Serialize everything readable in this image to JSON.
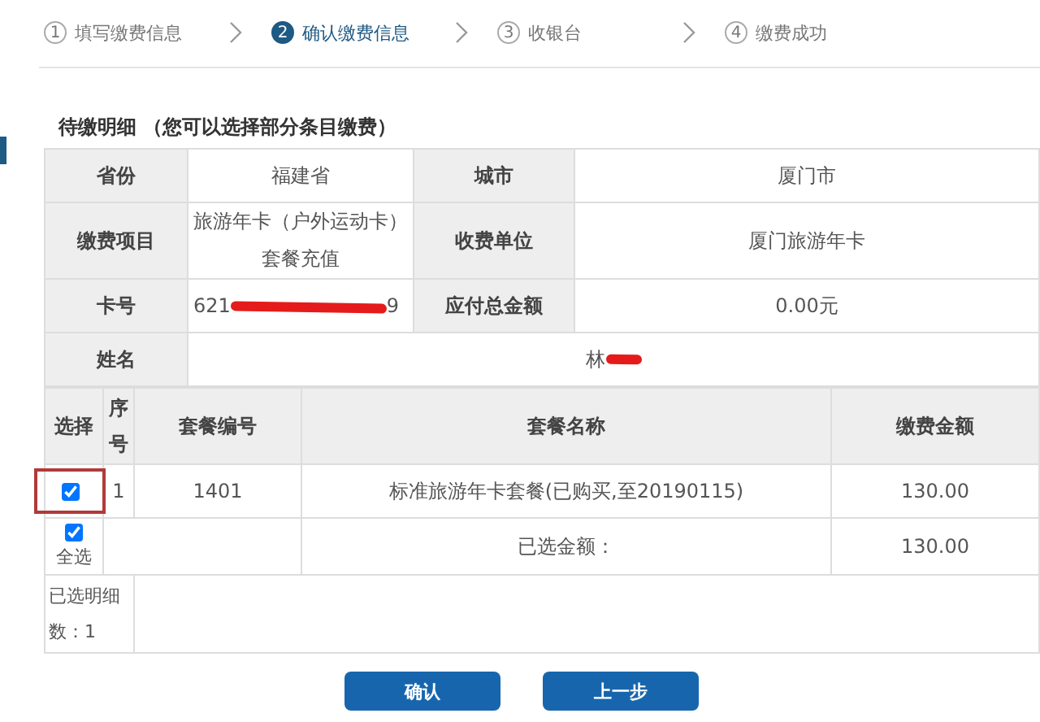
{
  "steps": [
    {
      "number": "1",
      "label": "填写缴费信息",
      "selected": false
    },
    {
      "number": "2",
      "label": "确认缴费信息",
      "selected": true
    },
    {
      "number": "3",
      "label": "收银台",
      "selected": false
    },
    {
      "number": "4",
      "label": "缴费成功",
      "selected": false
    }
  ],
  "section_title": "待缴明细 （您可以选择部分条目缴费）",
  "info_rows": [
    {
      "label": "省份",
      "value": "福建省",
      "label_2": "城市",
      "value_2": "厦门市"
    },
    {
      "label": "缴费项目",
      "value": "旅游年卡（户外运动卡）套餐充值",
      "label_2": "收费单位",
      "value_2": "厦门旅游年卡"
    },
    {
      "label": "卡号",
      "value": "621",
      "value_tail": "9",
      "redacted": true,
      "label_2": "应付总金额",
      "value_2": "0.00元"
    },
    {
      "label": "姓名",
      "value": "林",
      "redacted": true
    }
  ],
  "table": {
    "columns": [
      "选择",
      "序号",
      "套餐编号",
      "套餐名称",
      "缴费金额"
    ],
    "rows": [
      {
        "checked": true,
        "highlighted": true,
        "index": "1",
        "code": "1401",
        "name": "标准旅游年卡套餐(已购买,至20190115)",
        "amount": "130.00"
      }
    ],
    "select_all": {
      "checked": true,
      "label": "全选"
    },
    "total_label": "已选金额：",
    "total": "130.00",
    "count_text": "已选明细数：1"
  },
  "buttons": [
    "确认",
    "上一步"
  ]
}
